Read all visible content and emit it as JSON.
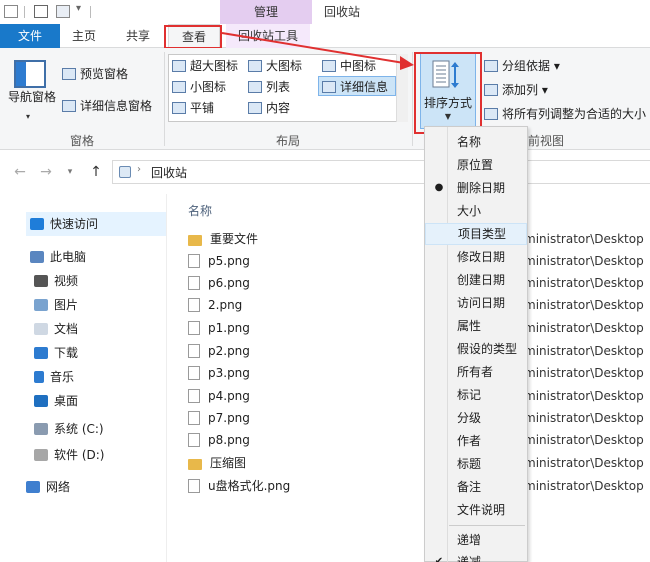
{
  "title_bar": {
    "context_tab_header": "管理",
    "window_title": "回收站"
  },
  "tabs": {
    "file": "文件",
    "home": "主页",
    "share": "共享",
    "view": "查看",
    "recycle_tools": "回收站工具"
  },
  "ribbon": {
    "pane_group": {
      "nav_pane": "导航窗格",
      "preview_pane": "预览窗格",
      "details_pane": "详细信息窗格",
      "label": "窗格"
    },
    "layout_group": {
      "items": [
        "超大图标",
        "大图标",
        "中图标",
        "小图标",
        "列表",
        "详细信息",
        "平铺",
        "内容"
      ],
      "selected": "详细信息",
      "label": "布局"
    },
    "current_view_group": {
      "sort_by": "排序方式",
      "group_by": "分组依据",
      "add_columns": "添加列",
      "size_all_columns": "将所有列调整为合适的大小",
      "label": "当前视图",
      "label_visible": "前视图"
    }
  },
  "address": {
    "location": "回收站"
  },
  "nav": {
    "items": [
      "快速访问",
      "此电脑",
      "视频",
      "图片",
      "文档",
      "下载",
      "音乐",
      "桌面",
      "系统 (C:)",
      "软件 (D:)",
      "网络"
    ]
  },
  "files": {
    "column_name": "名称",
    "rows": [
      {
        "name": "重要文件",
        "type": "folder"
      },
      {
        "name": "p5.png",
        "type": "file"
      },
      {
        "name": "p6.png",
        "type": "file"
      },
      {
        "name": "2.png",
        "type": "file"
      },
      {
        "name": "p1.png",
        "type": "file"
      },
      {
        "name": "p2.png",
        "type": "file"
      },
      {
        "name": "p3.png",
        "type": "file"
      },
      {
        "name": "p4.png",
        "type": "file"
      },
      {
        "name": "p7.png",
        "type": "file"
      },
      {
        "name": "p8.png",
        "type": "file"
      },
      {
        "name": "压缩图",
        "type": "folder"
      },
      {
        "name": "u盘格式化.png",
        "type": "file"
      }
    ],
    "original_location_fragment": "ministrator\\Desktop"
  },
  "sort_menu": {
    "items": [
      "名称",
      "原位置",
      "删除日期",
      "大小",
      "项目类型",
      "修改日期",
      "创建日期",
      "访问日期",
      "属性",
      "假设的类型",
      "所有者",
      "标记",
      "分级",
      "作者",
      "标题",
      "备注",
      "文件说明"
    ],
    "checked": "删除日期",
    "highlighted": "项目类型",
    "order_items": [
      "递增",
      "递减"
    ],
    "order_checked": "递减"
  },
  "colors": {
    "file_tab": "#1979ca",
    "context_tab": "#e4cdf0",
    "highlight_box": "#e03030",
    "selection": "#cce4f7"
  }
}
